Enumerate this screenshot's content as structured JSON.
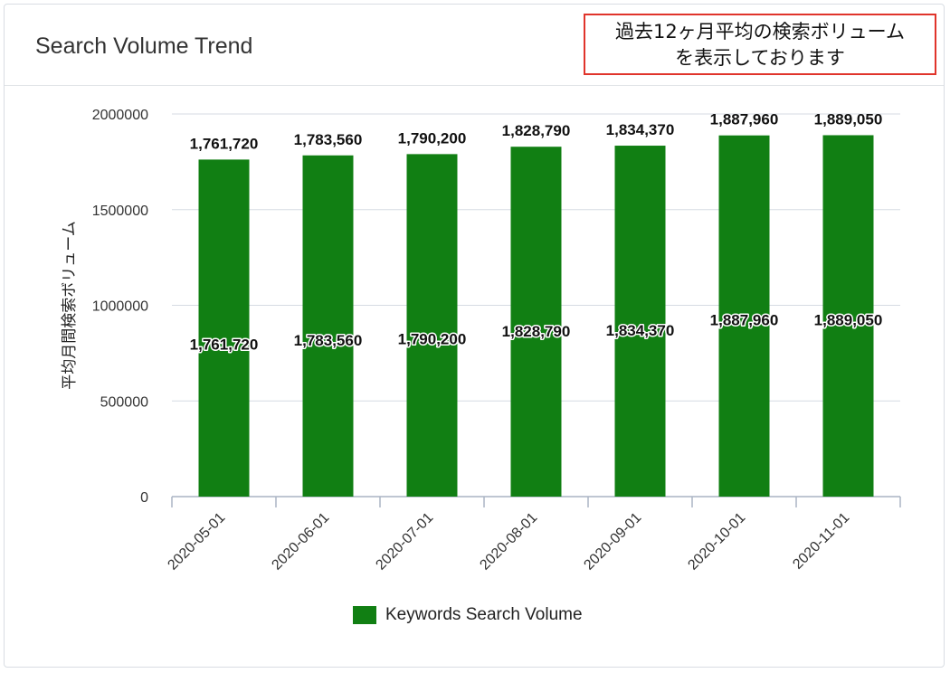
{
  "header": {
    "title": "Search Volume Trend",
    "note_line1": "過去12ヶ月平均の検索ボリューム",
    "note_line2": "を表示しております"
  },
  "colors": {
    "bar": "#117f13",
    "note_border": "#e0342b",
    "grid": "#d6dbe3"
  },
  "chart_data": {
    "type": "bar",
    "categories": [
      "2020-05-01",
      "2020-06-01",
      "2020-07-01",
      "2020-08-01",
      "2020-09-01",
      "2020-10-01",
      "2020-11-01"
    ],
    "series": [
      {
        "name": "Keywords Search Volume",
        "values": [
          1761720,
          1783560,
          1790200,
          1828790,
          1834370,
          1887960,
          1889050
        ],
        "labels": [
          "1,761,720",
          "1,783,560",
          "1,790,200",
          "1,828,790",
          "1,834,370",
          "1,887,960",
          "1,889,050"
        ]
      }
    ],
    "ylabel": "平均月間検索ボリューム",
    "xlabel": "",
    "ylim": [
      0,
      2000000
    ],
    "yticks": [
      0,
      500000,
      1000000,
      1500000,
      2000000
    ],
    "ytick_labels": [
      "0",
      "500000",
      "1000000",
      "1500000",
      "2000000"
    ],
    "grid": true,
    "legend_position": "bottom"
  }
}
